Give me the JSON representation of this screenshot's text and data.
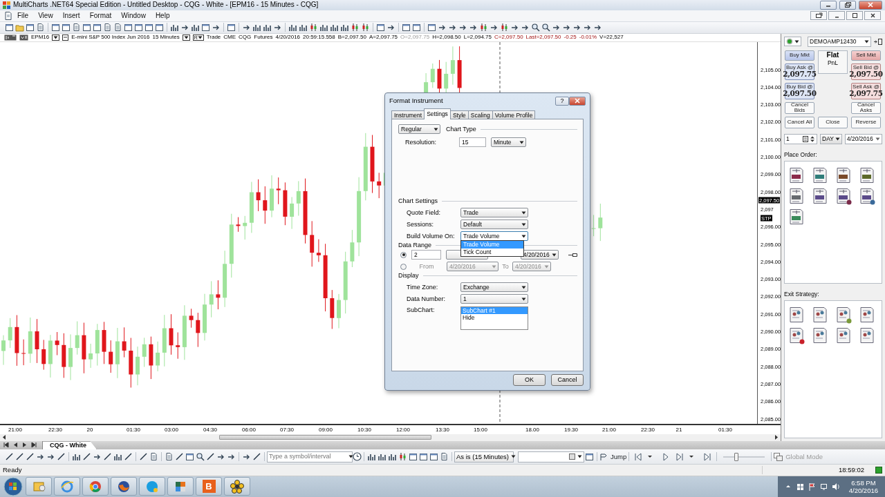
{
  "window": {
    "title": "MultiCharts .NET64 Special Edition - Untitled Desktop - CQG - White - [EPM16 - 15 Minutes - CQG]"
  },
  "menu": [
    "File",
    "View",
    "Insert",
    "Format",
    "Window",
    "Help"
  ],
  "symbol_bar": {
    "symbol": "EPM16",
    "description": "E-mini S&P 500 Index Jun 2016",
    "interval": "15 Minutes",
    "quote_badge": "R",
    "quote_field": "Trade",
    "fields": [
      {
        "text": "CME",
        "kind": "plain"
      },
      {
        "text": "CQG",
        "kind": "plain"
      },
      {
        "text": "Futures",
        "kind": "plain"
      },
      {
        "text": "4/20/2016",
        "kind": "plain"
      },
      {
        "text": "20:59:15.558",
        "kind": "plain"
      },
      {
        "text": "B=2,097.50",
        "kind": "plain"
      },
      {
        "text": "A=2,097.75",
        "kind": "plain"
      },
      {
        "text": "O=2,097.75",
        "kind": "muted"
      },
      {
        "text": "H=2,098.50",
        "kind": "plain"
      },
      {
        "text": "L=2,094.75",
        "kind": "plain"
      },
      {
        "text": "C=2,097.50",
        "kind": "down"
      },
      {
        "text": "Last=2,097.50",
        "kind": "down"
      },
      {
        "text": "-0.25",
        "kind": "down"
      },
      {
        "text": "-0.01%",
        "kind": "down"
      },
      {
        "text": "V=22,527",
        "kind": "plain"
      }
    ]
  },
  "chart": {
    "price_labels": [
      "2,105.00",
      "2,104.00",
      "2,103.00",
      "2,102.00",
      "2,101.00",
      "2,100.00",
      "2,099.00",
      "2,098.00",
      "2,097",
      "2,096.00",
      "2,095.00",
      "2,094.00",
      "2,093.00",
      "2,092.00",
      "2,091.00",
      "2,090.00",
      "2,089.00",
      "2,088.00",
      "2,087.00",
      "2,086.00",
      "2,085.00"
    ],
    "last_price_marker": "2,097.50",
    "order_marker": "STP",
    "time_labels": [
      "21:00",
      "22:30",
      "20",
      "01:30",
      "03:00",
      "04:30",
      "06:00",
      "07:30",
      "09:00",
      "10:30",
      "12:00",
      "13:30",
      "15:00",
      "18.00",
      "19.30",
      "21:00",
      "22:30",
      "21",
      "01:30"
    ]
  },
  "trade_panel": {
    "account": "DEMOAMP12430",
    "buy_buttons": [
      {
        "kind": "market",
        "label": "Buy Mkt"
      },
      {
        "kind": "limit",
        "label": "Buy Ask @",
        "price": "2,097.75"
      },
      {
        "kind": "limit",
        "label": "Buy Bid @",
        "price": "2,097.50"
      },
      {
        "kind": "cancel",
        "label": "Cancel Bids"
      }
    ],
    "position": {
      "status": "Flat",
      "pnl": "PnL"
    },
    "sell_buttons": [
      {
        "kind": "market",
        "label": "Sell Mkt"
      },
      {
        "kind": "limit",
        "label": "Sell Bid @",
        "price": "2,097.50"
      },
      {
        "kind": "limit",
        "label": "Sell Ask @",
        "price": "2,097.75"
      },
      {
        "kind": "cancel",
        "label": "Cancel Asks"
      }
    ],
    "action_buttons": [
      "Cancel All",
      "Close",
      "Reverse"
    ],
    "quantity": "1",
    "duration": "DAY",
    "date": "4/20/2016",
    "place_order_title": "Place Order:",
    "exit_strategy_title": "Exit Strategy:"
  },
  "dialog": {
    "title": "Format Instrument",
    "help": "?",
    "tabs": [
      {
        "label": "Instrument",
        "selected": false
      },
      {
        "label": "Settings",
        "selected": true
      },
      {
        "label": "Style",
        "selected": false
      },
      {
        "label": "Scaling",
        "selected": false
      },
      {
        "label": "Volume Profile",
        "selected": false
      }
    ],
    "chart_type": {
      "value": "Regular",
      "label": "Chart Type"
    },
    "resolution": {
      "label": "Resolution:",
      "value": "15",
      "unit": "Minute"
    },
    "chart_settings": {
      "title": "Chart Settings",
      "fields": [
        {
          "label": "Quote Field:",
          "value": "Trade",
          "expanded": false
        },
        {
          "label": "Sessions:",
          "value": "Default",
          "expanded": false
        },
        {
          "label": "Build Volume On:",
          "value": "Trade Volume",
          "expanded": true
        }
      ],
      "options": [
        {
          "label": "Trade Volume",
          "selected": true
        },
        {
          "label": "Tick Count",
          "selected": false
        }
      ]
    },
    "data_range": {
      "title": "Data Range",
      "options": [
        {
          "kind": "days_back",
          "selected": true,
          "value": "2",
          "date": "4/20/2016"
        },
        {
          "kind": "from_to",
          "selected": false,
          "from_label": "From",
          "from": "4/20/2016",
          "to_label": "To",
          "to": "4/20/2016"
        }
      ]
    },
    "display": {
      "title": "Display",
      "fields": [
        {
          "label": "Time Zone:",
          "value": "Exchange"
        },
        {
          "label": "Data Number:",
          "value": "1"
        }
      ],
      "subchart": {
        "label": "SubChart:",
        "items": [
          {
            "label": "SubChart #1",
            "selected": true
          },
          {
            "label": "Hide",
            "selected": false
          }
        ]
      }
    },
    "buttons": [
      "OK",
      "Cancel"
    ]
  },
  "sheet_tabs": [
    {
      "label": "CQG - White",
      "selected": true
    }
  ],
  "drawing_toolbar": {
    "symbol_placeholder": "Type a symbol/interval",
    "interval": "As is (15 Minutes)",
    "jump": "Jump",
    "zoom_slider": {
      "level": 0.3
    },
    "global_mode": {
      "label": "Global Mode",
      "disabled": true
    }
  },
  "status_bar": {
    "text": "Ready",
    "time": "18:59:02"
  },
  "taskbar": {
    "app_letter": "B",
    "time": "6:58 PM",
    "date": "4/20/2016"
  }
}
